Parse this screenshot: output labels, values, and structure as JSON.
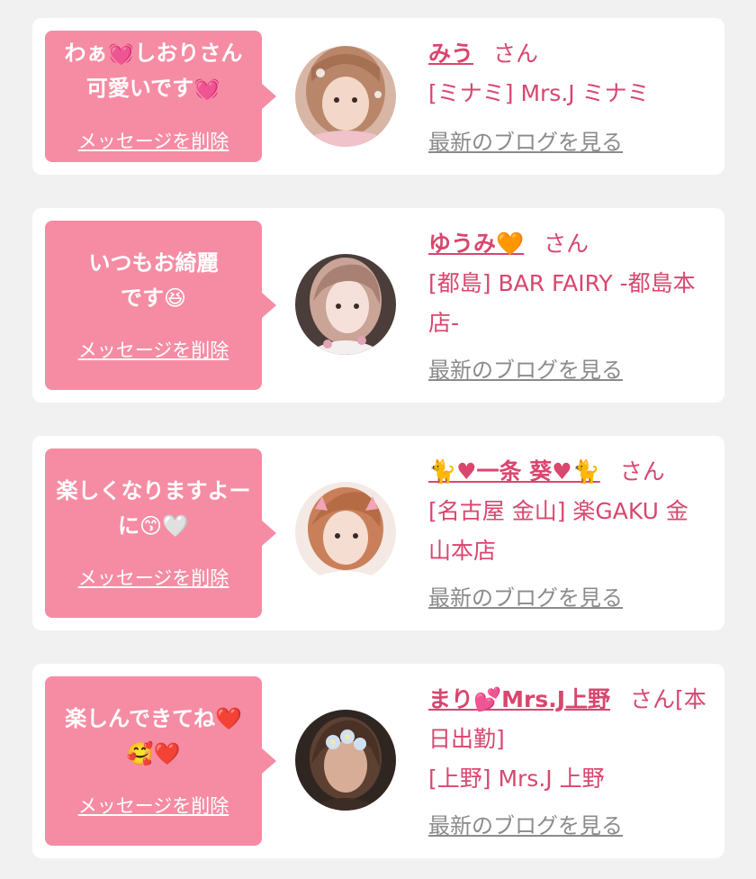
{
  "delete_label": "メッセージを削除",
  "honorific": "さん",
  "blog_label": "最新のブログを見る",
  "colors": {
    "background": "#f1f1f1",
    "card": "#ffffff",
    "bubble": "#f58ca3",
    "accent": "#d9466e",
    "muted": "#8b8b8b"
  },
  "messages": [
    {
      "message": "わぁ💓しおりさん可愛いです💓",
      "name": "みう",
      "shop": "[ミナミ] Mrs.J ミナミ",
      "avatar_icon": "avatar-photo"
    },
    {
      "message": "いつもお綺麗です😆",
      "name": "ゆうみ🧡",
      "shop": "[都島] BAR FAIRY -都島本店-",
      "avatar_icon": "avatar-photo"
    },
    {
      "message": "楽しくなりますよーに😙🤍",
      "name": "🐈♥一条 葵♥🐈",
      "shop": "[名古屋 金山] 楽GAKU 金山本店",
      "avatar_icon": "avatar-photo"
    },
    {
      "message": "楽しんできてね❤️🥰❤️",
      "name": "まり💕Mrs.J上野",
      "name_suffix": "[本日出勤]",
      "shop": "[上野] Mrs.J 上野",
      "avatar_icon": "avatar-photo"
    }
  ]
}
